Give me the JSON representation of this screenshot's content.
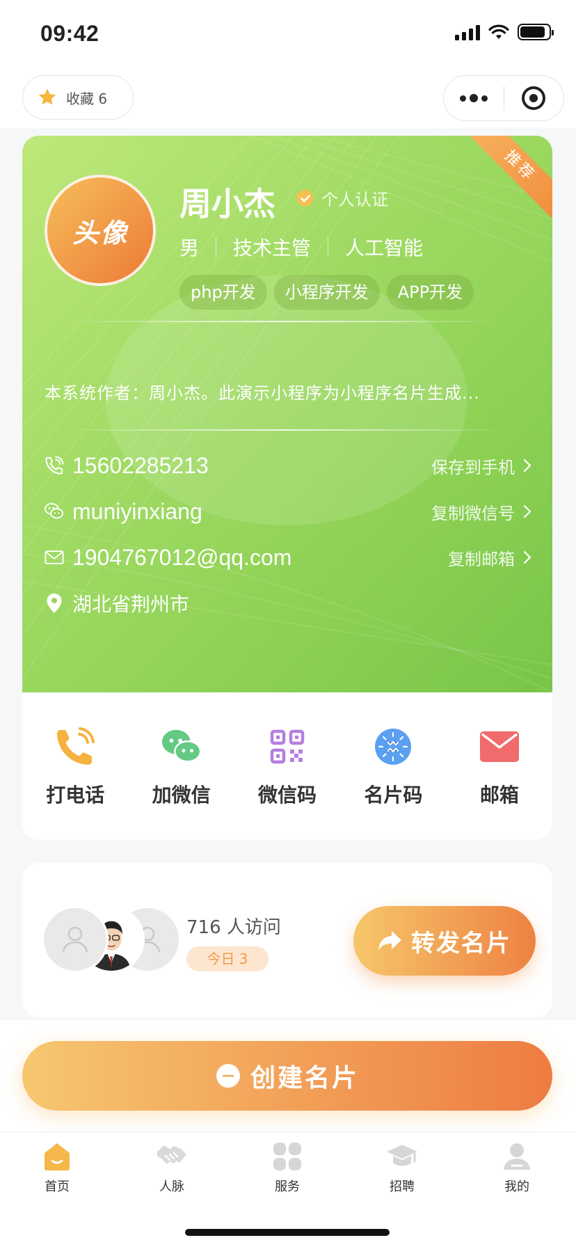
{
  "status_bar": {
    "time": "09:42"
  },
  "top_nav": {
    "favorite_label": "收藏 6"
  },
  "card": {
    "ribbon": "推荐",
    "avatar_text": "头像",
    "name": "周小杰",
    "verify_label": "个人认证",
    "gender": "男",
    "position": "技术主管",
    "industry": "人工智能",
    "tags": [
      "php开发",
      "小程序开发",
      "APP开发"
    ],
    "intro": "本系统作者：周小杰。此演示小程序为小程序名片生成...",
    "contacts": {
      "phone": {
        "value": "15602285213",
        "action": "保存到手机"
      },
      "wechat": {
        "value": "muniyinxiang",
        "action": "复制微信号"
      },
      "email": {
        "value": "1904767012@qq.com",
        "action": "复制邮箱"
      },
      "address": {
        "value": "湖北省荆州市"
      }
    },
    "actions": [
      {
        "label": "打电话",
        "icon": "phone-icon",
        "color": "#f5a623"
      },
      {
        "label": "加微信",
        "icon": "wechat-icon",
        "color": "#5cc97b"
      },
      {
        "label": "微信码",
        "icon": "qrcode-icon",
        "color": "#b57fe0"
      },
      {
        "label": "名片码",
        "icon": "mini-program-code-icon",
        "color": "#5b9ff0"
      },
      {
        "label": "邮箱",
        "icon": "mail-icon",
        "color": "#f06b6b"
      }
    ]
  },
  "visits": {
    "count_label": "716 人访问",
    "today_label": "今日 3",
    "share_label": "转发名片"
  },
  "create_label": "创建名片",
  "tabbar": [
    {
      "label": "首页",
      "icon": "home-icon",
      "active": true
    },
    {
      "label": "人脉",
      "icon": "handshake-icon",
      "active": false
    },
    {
      "label": "服务",
      "icon": "grid-icon",
      "active": false
    },
    {
      "label": "招聘",
      "icon": "graduation-cap-icon",
      "active": false
    },
    {
      "label": "我的",
      "icon": "user-icon",
      "active": false
    }
  ],
  "colors": {
    "accent_orange": "#ee7c42",
    "card_green": "#8dd154"
  }
}
